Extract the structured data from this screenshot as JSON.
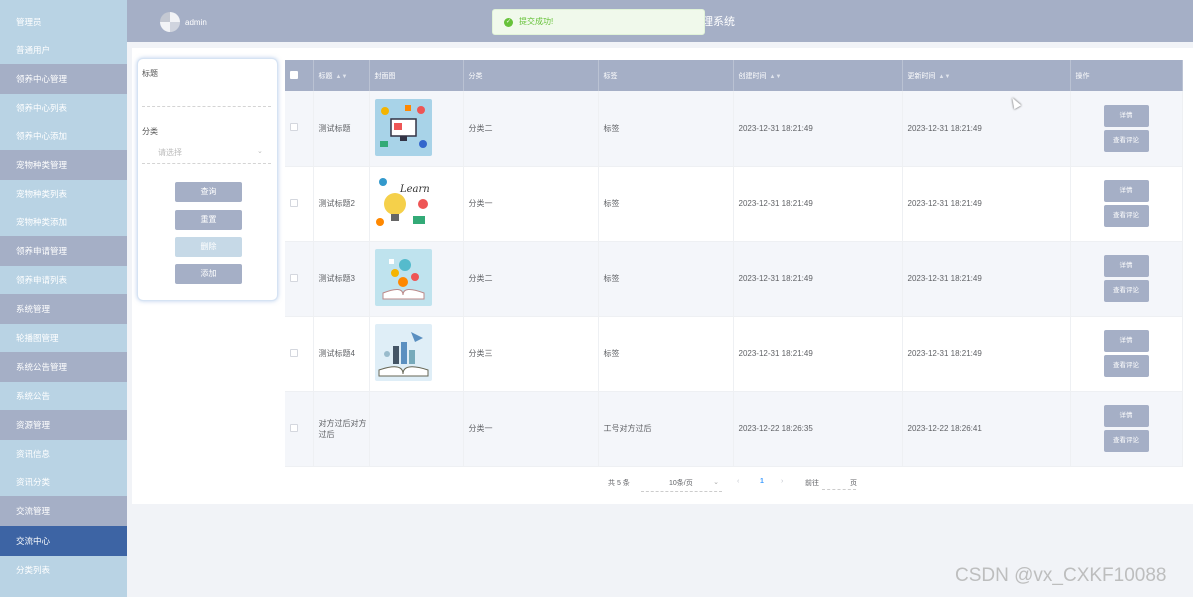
{
  "sidebar": {
    "items": [
      {
        "label": "管理员",
        "kind": "sub"
      },
      {
        "label": "普通用户",
        "kind": "sub"
      },
      {
        "label": "领养中心管理",
        "kind": "group"
      },
      {
        "label": "领养中心列表",
        "kind": "sub"
      },
      {
        "label": "领养中心添加",
        "kind": "sub"
      },
      {
        "label": "宠物种类管理",
        "kind": "group"
      },
      {
        "label": "宠物种类列表",
        "kind": "sub"
      },
      {
        "label": "宠物种类添加",
        "kind": "sub"
      },
      {
        "label": "领养申请管理",
        "kind": "group"
      },
      {
        "label": "领养申请列表",
        "kind": "sub"
      },
      {
        "label": "系统管理",
        "kind": "group"
      },
      {
        "label": "轮播图管理",
        "kind": "sub"
      },
      {
        "label": "系统公告管理",
        "kind": "group"
      },
      {
        "label": "系统公告",
        "kind": "sub"
      },
      {
        "label": "资源管理",
        "kind": "group"
      },
      {
        "label": "资讯信息",
        "kind": "sub"
      },
      {
        "label": "资讯分类",
        "kind": "sub"
      },
      {
        "label": "交流管理",
        "kind": "group"
      },
      {
        "label": "交流中心",
        "kind": "active"
      },
      {
        "label": "分类列表",
        "kind": "sub"
      }
    ]
  },
  "header": {
    "username": "admin",
    "title_partial": "理系统"
  },
  "toast": {
    "message": "提交成功!",
    "icon": "check-circle-icon"
  },
  "search": {
    "title_label": "标题",
    "category_label": "分类",
    "category_placeholder": "请选择",
    "buttons": {
      "query": "查询",
      "reset": "重置",
      "delete": "删除",
      "add": "添加"
    }
  },
  "table": {
    "headers": [
      "标题",
      "封面图",
      "分类",
      "标签",
      "创建时间",
      "更新时间",
      "操作"
    ],
    "rows": [
      {
        "title": "测试标题",
        "category": "分类二",
        "tag": "标签",
        "created": "2023-12-31 18:21:49",
        "updated": "2023-12-31 18:21:49",
        "cover": "computer-illustration"
      },
      {
        "title": "测试标题2",
        "category": "分类一",
        "tag": "标签",
        "created": "2023-12-31 18:21:49",
        "updated": "2023-12-31 18:21:49",
        "cover": "learn-illustration"
      },
      {
        "title": "测试标题3",
        "category": "分类二",
        "tag": "标签",
        "created": "2023-12-31 18:21:49",
        "updated": "2023-12-31 18:21:49",
        "cover": "book-illustration"
      },
      {
        "title": "测试标题4",
        "category": "分类三",
        "tag": "标签",
        "created": "2023-12-31 18:21:49",
        "updated": "2023-12-31 18:21:49",
        "cover": "open-book-illustration"
      },
      {
        "title": "对方过后对方过后",
        "category": "分类一",
        "tag": "工号对方过后",
        "created": "2023-12-22 18:26:35",
        "updated": "2023-12-22 18:26:41",
        "cover": "empty"
      }
    ],
    "actions": {
      "detail": "详情",
      "comments": "查看评论"
    }
  },
  "pagination": {
    "total": "共 5 条",
    "page_size": "10条/页",
    "prev": "‹",
    "current": "1",
    "next": "›",
    "goto_prefix": "前往",
    "goto_suffix": "页"
  },
  "watermark": "CSDN @vx_CXKF10088",
  "colors": {
    "sidebar_bg": "#b9d3e4",
    "group_bg": "#a5afc6",
    "active_bg": "#3d64a4",
    "header_bg": "#a5afc6",
    "success": "#67c23a"
  }
}
